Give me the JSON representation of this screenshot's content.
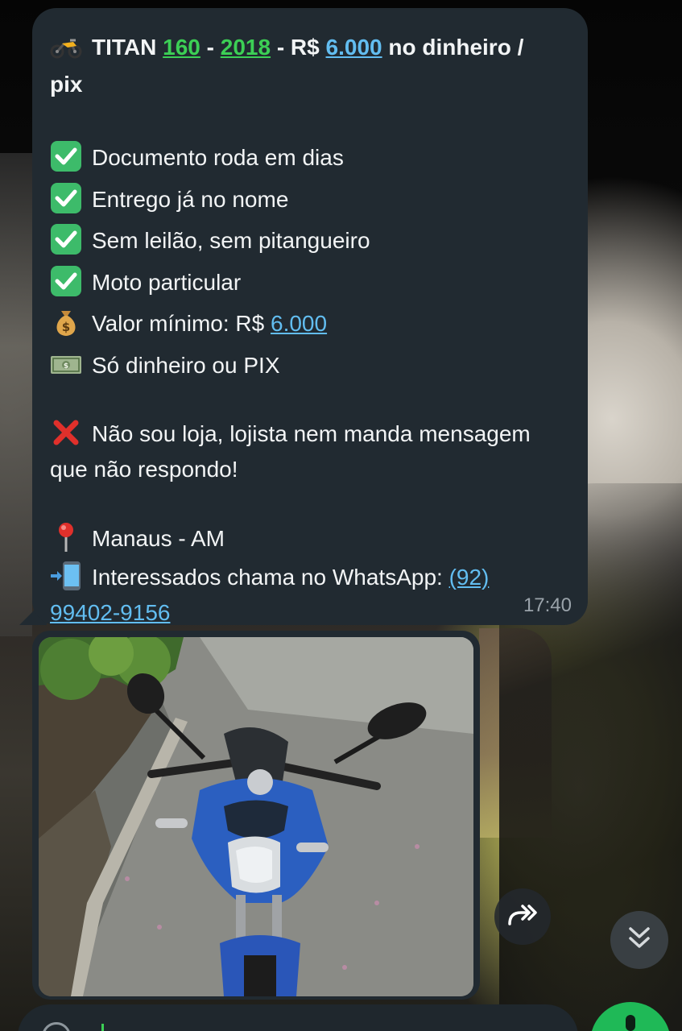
{
  "message": {
    "title_parts": {
      "prefix": "TITAN ",
      "cc": "160",
      "sep1": " - ",
      "year": "2018",
      "sep2": " - R$ ",
      "price": "6.000",
      "suffix": " no dinheiro /",
      "line2": "pix"
    },
    "items": [
      {
        "icon": "check-mark-icon",
        "text": "Documento roda em dias"
      },
      {
        "icon": "check-mark-icon",
        "text": "Entrego já no nome"
      },
      {
        "icon": "check-mark-icon",
        "text": "Sem leilão, sem pitangueiro"
      },
      {
        "icon": "check-mark-icon",
        "text": "Moto particular"
      }
    ],
    "min_value_label": "Valor mínimo: R$ ",
    "min_value": "6.000",
    "payment_text": "Só dinheiro ou PIX",
    "warning_text": "Não sou loja, lojista nem manda mensagem que não respondo!",
    "location_text": "Manaus - AM",
    "contact_label": "Interessados chama no WhatsApp: ",
    "phone_part1": "(92)",
    "phone_part2": "99402-9156",
    "time": "17:40"
  },
  "icons": {
    "title_icon": "motorcycle-icon",
    "min_value_icon": "money-bag-icon",
    "payment_icon": "banknote-icon",
    "warning_icon": "cross-mark-icon",
    "location_icon": "round-pushpin-icon",
    "contact_icon": "mobile-phone-arrow-icon",
    "forward_button_icon": "forward-arrows-icon",
    "scroll_down_icon": "double-chevron-down-icon"
  },
  "colors": {
    "bubble": "#212a31",
    "link_blue": "#62bdf0",
    "number_green": "#3ccf55",
    "check_green": "#3dbb6a",
    "timestamp": "#9aa3aa"
  }
}
